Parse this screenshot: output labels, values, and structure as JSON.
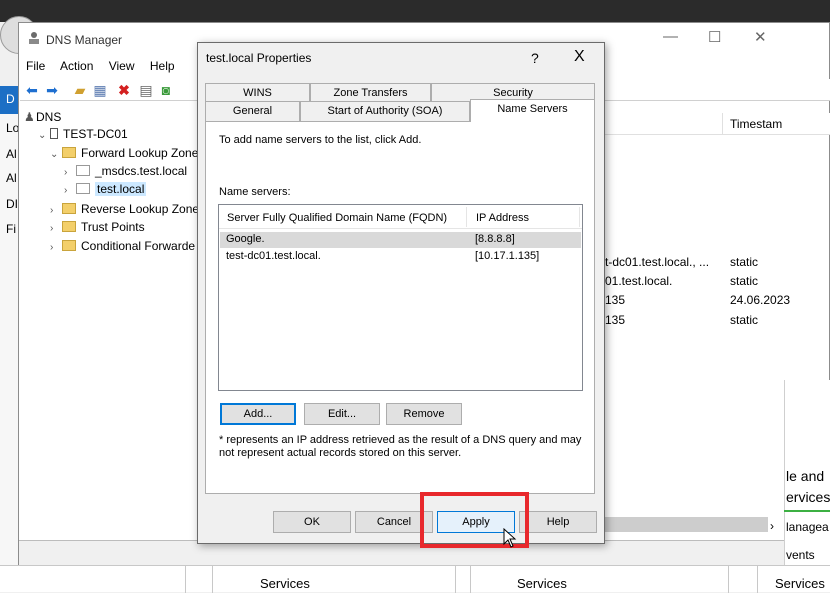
{
  "dns_manager": {
    "title": "DNS Manager",
    "menu": [
      "File",
      "Action",
      "View",
      "Help"
    ],
    "tree": {
      "root": "DNS",
      "server": "TEST-DC01",
      "forward_zones": "Forward Lookup Zone",
      "msdcs": "_msdcs.test.local",
      "test_local": "test.local",
      "reverse_zones": "Reverse Lookup Zone",
      "trust_points": "Trust Points",
      "conditional_forwarders": "Conditional Forwarde"
    },
    "list": {
      "timestamp_header": "Timestam",
      "rows": [
        {
          "data": "t-dc01.test.local., ...",
          "ts": "static"
        },
        {
          "data": "01.test.local.",
          "ts": "static"
        },
        {
          "data": "135",
          "ts": "24.06.2023"
        },
        {
          "data": "135",
          "ts": "static"
        }
      ]
    }
  },
  "background": {
    "left_nav": [
      "D",
      "Lo",
      "Al",
      "Al",
      "DI",
      "Fi"
    ],
    "right_text": [
      "le and",
      "ervices",
      "lanagea",
      "vents"
    ],
    "services": [
      "Services",
      "Services",
      "Services"
    ]
  },
  "dialog": {
    "title": "test.local Properties",
    "help_glyph": "?",
    "close_glyph": "X",
    "tabs_row1": [
      "WINS",
      "Zone Transfers",
      "Security"
    ],
    "tabs_row2": [
      "General",
      "Start of Authority (SOA)",
      "Name Servers"
    ],
    "intro": "To add name servers to the list, click Add.",
    "list_label": "Name servers:",
    "columns": [
      "Server Fully Qualified Domain Name (FQDN)",
      "IP Address"
    ],
    "rows": [
      {
        "fqdn": "Google.",
        "ip": "[8.8.8.8]"
      },
      {
        "fqdn": "test-dc01.test.local.",
        "ip": "[10.17.1.135]"
      }
    ],
    "add_label": "Add...",
    "edit_label": "Edit...",
    "remove_label": "Remove",
    "note_line1": "* represents an IP address retrieved as the result of a DNS query and may",
    "note_line2": "not represent actual records stored on this server.",
    "ok_label": "OK",
    "cancel_label": "Cancel",
    "apply_label": "Apply",
    "help_label": "Help"
  },
  "colors": {
    "accent": "#0078d7",
    "highlight": "#e8282c",
    "selection": "#cce8ff"
  }
}
